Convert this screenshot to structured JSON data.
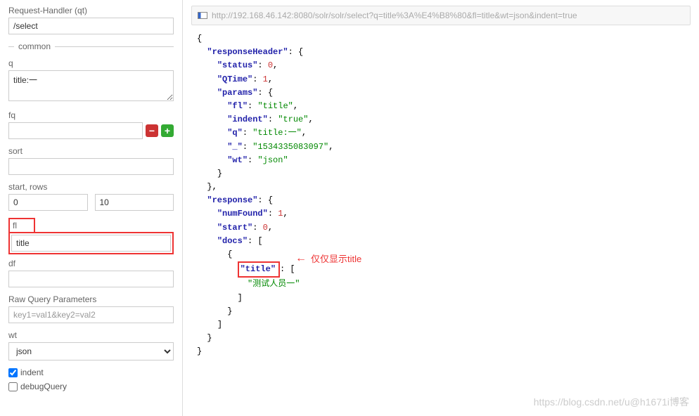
{
  "sidebar": {
    "qt": {
      "label": "Request-Handler (qt)",
      "value": "/select"
    },
    "common_legend": "common",
    "q": {
      "label": "q",
      "value": "title:一"
    },
    "fq": {
      "label": "fq",
      "value": ""
    },
    "sort": {
      "label": "sort",
      "value": ""
    },
    "startrows": {
      "label": "start, rows",
      "start": "0",
      "rows": "10"
    },
    "fl": {
      "label": "fl",
      "value": "title"
    },
    "df": {
      "label": "df",
      "value": ""
    },
    "rawq": {
      "label": "Raw Query Parameters",
      "placeholder": "key1=val1&key2=val2"
    },
    "wt": {
      "label": "wt",
      "value": "json"
    },
    "indent_label": "indent",
    "debug_label": "debugQuery"
  },
  "url": "http://192.168.46.142:8080/solr/solr/select?q=title%3A%E4%B8%80&fl=title&wt=json&indent=true",
  "json": {
    "l1": "{",
    "l2a": "\"responseHeader\"",
    "l2b": ": {",
    "l3a": "\"status\"",
    "l3b": ": ",
    "l3c": "0",
    "l3d": ",",
    "l4a": "\"QTime\"",
    "l4b": ": ",
    "l4c": "1",
    "l4d": ",",
    "l5a": "\"params\"",
    "l5b": ": {",
    "l6a": "\"fl\"",
    "l6b": ": ",
    "l6c": "\"title\"",
    "l6d": ",",
    "l7a": "\"indent\"",
    "l7b": ": ",
    "l7c": "\"true\"",
    "l7d": ",",
    "l8a": "\"q\"",
    "l8b": ": ",
    "l8c": "\"title:一\"",
    "l8d": ",",
    "l9a": "\"_\"",
    "l9b": ": ",
    "l9c": "\"1534335083097\"",
    "l9d": ",",
    "l10a": "\"wt\"",
    "l10b": ": ",
    "l10c": "\"json\"",
    "l11": "}",
    "l12": "},",
    "l13a": "\"response\"",
    "l13b": ": {",
    "l14a": "\"numFound\"",
    "l14b": ": ",
    "l14c": "1",
    "l14d": ",",
    "l15a": "\"start\"",
    "l15b": ": ",
    "l15c": "0",
    "l15d": ",",
    "l16a": "\"docs\"",
    "l16b": ": [",
    "l17": "{",
    "l18a": "\"title\"",
    "l18b": ": [",
    "l19": "\"测试人员一\"",
    "l20": "]",
    "l21": "}",
    "l22": "]",
    "l23": "}",
    "l24": "}"
  },
  "annotation": {
    "arrow": "←",
    "text": "仅仅显示title"
  },
  "watermark": "https://blog.csdn.net/u@h1671i博客"
}
